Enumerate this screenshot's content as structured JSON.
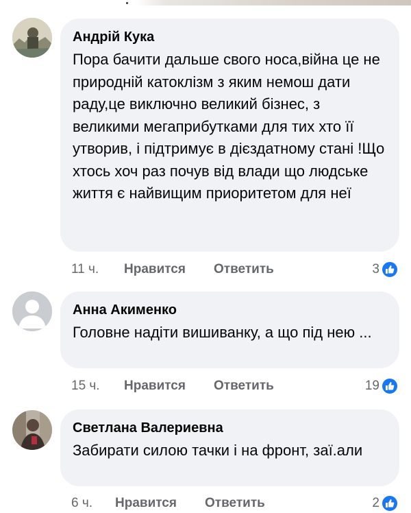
{
  "comments": [
    {
      "author": "Андрій Кука",
      "text": "Пора бачити дальше свого носа,війна це не природній катоклізм з яким немош дати раду,це виключно великий бізнес, з великими мегаприбутками для тих хто її утворив, і підтримує в дієздатному стані !Що хтось хоч раз почув від влади що людське життя є найвищим приоритетом для неї",
      "time": "11 ч.",
      "like_label": "Нравится",
      "reply_label": "Ответить",
      "reactions": "3"
    },
    {
      "author": "Анна Акименко",
      "text": "Головне надіти вишиванку, а що під нею ...",
      "time": "15 ч.",
      "like_label": "Нравится",
      "reply_label": "Ответить",
      "reactions": "19"
    },
    {
      "author": "Светлана Валериевна",
      "text": "Забирати силою тачки і на фронт, заї.али",
      "time": "6 ч.",
      "like_label": "Нравится",
      "reply_label": "Ответить",
      "reactions": "2"
    }
  ],
  "icons": {
    "reaction": "like-thumb-icon",
    "default_avatar": "default-avatar-icon"
  },
  "colors": {
    "bubble": "#f0f2f5",
    "meta_text": "#65676b",
    "like_blue": "#1877f2"
  }
}
